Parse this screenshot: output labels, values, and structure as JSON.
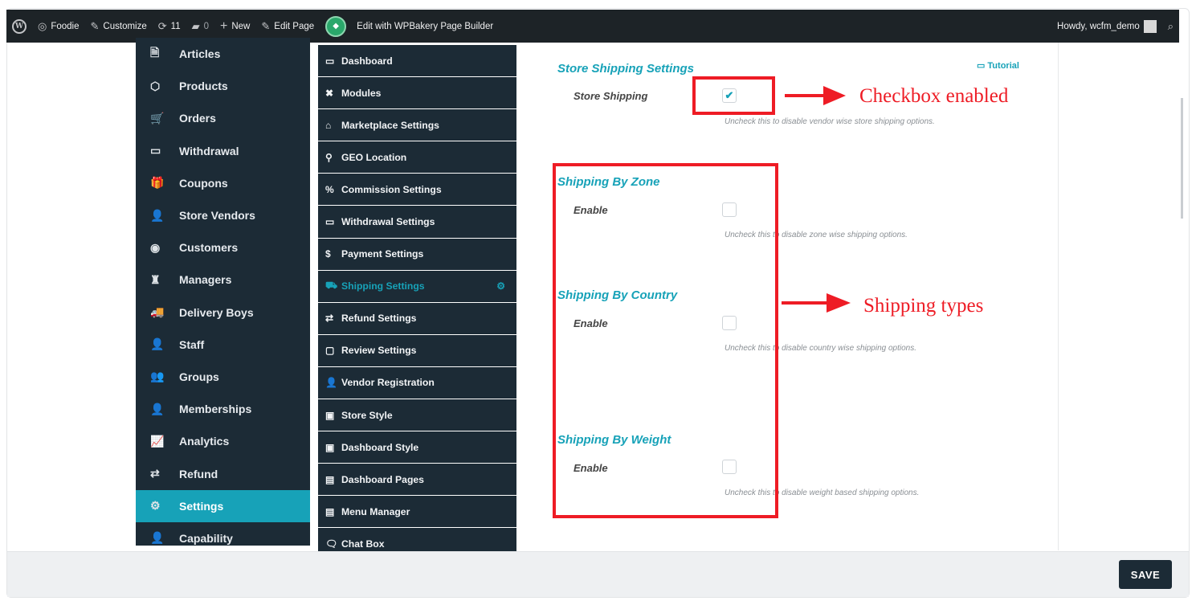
{
  "adminbar": {
    "site_name": "Foodie",
    "customize": "Customize",
    "updates_count": "11",
    "comments_count": "0",
    "new": "New",
    "edit_page": "Edit Page",
    "wpbakery": "Edit with WPBakery Page Builder",
    "howdy": "Howdy, wcfm_demo"
  },
  "leftnav": {
    "items": [
      {
        "label": "Articles",
        "icon": "document-icon",
        "glyph": "🗎"
      },
      {
        "label": "Products",
        "icon": "cube-icon",
        "glyph": "⬡"
      },
      {
        "label": "Orders",
        "icon": "cart-icon",
        "glyph": "🛒"
      },
      {
        "label": "Withdrawal",
        "icon": "card-icon",
        "glyph": "▭"
      },
      {
        "label": "Coupons",
        "icon": "gift-icon",
        "glyph": "🎁"
      },
      {
        "label": "Store Vendors",
        "icon": "user-icon",
        "glyph": "👤"
      },
      {
        "label": "Customers",
        "icon": "user-circle-icon",
        "glyph": "◉"
      },
      {
        "label": "Managers",
        "icon": "manager-icon",
        "glyph": "♜"
      },
      {
        "label": "Delivery Boys",
        "icon": "truck-icon",
        "glyph": "🚚"
      },
      {
        "label": "Staff",
        "icon": "staff-icon",
        "glyph": "👤"
      },
      {
        "label": "Groups",
        "icon": "groups-icon",
        "glyph": "👥"
      },
      {
        "label": "Memberships",
        "icon": "user-plus-icon",
        "glyph": "👤"
      },
      {
        "label": "Analytics",
        "icon": "chart-icon",
        "glyph": "📈"
      },
      {
        "label": "Refund",
        "icon": "refund-icon",
        "glyph": "⇄"
      },
      {
        "label": "Settings",
        "icon": "gears-icon",
        "glyph": "⚙"
      },
      {
        "label": "Capability",
        "icon": "user-x-icon",
        "glyph": "👤"
      }
    ]
  },
  "subnav": {
    "items": [
      {
        "label": "Dashboard",
        "icon": "monitor-icon",
        "glyph": "▭"
      },
      {
        "label": "Modules",
        "icon": "modules-icon",
        "glyph": "✖"
      },
      {
        "label": "Marketplace Settings",
        "icon": "home-icon",
        "glyph": "⌂"
      },
      {
        "label": "GEO Location",
        "icon": "location-icon",
        "glyph": "⚲"
      },
      {
        "label": "Commission Settings",
        "icon": "percent-icon",
        "glyph": "%"
      },
      {
        "label": "Withdrawal Settings",
        "icon": "card-icon",
        "glyph": "▭"
      },
      {
        "label": "Payment Settings",
        "icon": "dollar-icon",
        "glyph": "$"
      },
      {
        "label": "Shipping Settings",
        "icon": "truck-icon",
        "glyph": "⛟"
      },
      {
        "label": "Refund Settings",
        "icon": "refund-icon",
        "glyph": "⇄"
      },
      {
        "label": "Review Settings",
        "icon": "comment-icon",
        "glyph": "▢"
      },
      {
        "label": "Vendor Registration",
        "icon": "user-icon",
        "glyph": "👤"
      },
      {
        "label": "Store Style",
        "icon": "image-icon",
        "glyph": "▣"
      },
      {
        "label": "Dashboard Style",
        "icon": "image-icon",
        "glyph": "▣"
      },
      {
        "label": "Dashboard Pages",
        "icon": "pages-icon",
        "glyph": "▤"
      },
      {
        "label": "Menu Manager",
        "icon": "menu-icon",
        "glyph": "▤"
      },
      {
        "label": "Chat Box",
        "icon": "chat-icon",
        "glyph": "🗨"
      }
    ]
  },
  "main": {
    "tutorial": "Tutorial",
    "store_shipping": {
      "title": "Store Shipping Settings",
      "label": "Store Shipping",
      "checked": true,
      "desc": "Uncheck this to disable vendor wise store shipping options."
    },
    "by_zone": {
      "title": "Shipping By Zone",
      "label": "Enable",
      "checked": false,
      "desc": "Uncheck this to disable zone wise shipping options."
    },
    "by_country": {
      "title": "Shipping By Country",
      "label": "Enable",
      "checked": false,
      "desc": "Uncheck this to disable country wise shipping options."
    },
    "by_weight": {
      "title": "Shipping By Weight",
      "label": "Enable",
      "checked": false,
      "desc": "Uncheck this to disable weight based shipping options."
    }
  },
  "annotations": {
    "checkbox_enabled": "Checkbox enabled",
    "shipping_types": "Shipping types",
    "color": "#ee1c25"
  },
  "save_label": "SAVE",
  "colors": {
    "accent": "#17a2b8",
    "sidebar": "#1c2b36",
    "adminbar": "#1d2327"
  }
}
